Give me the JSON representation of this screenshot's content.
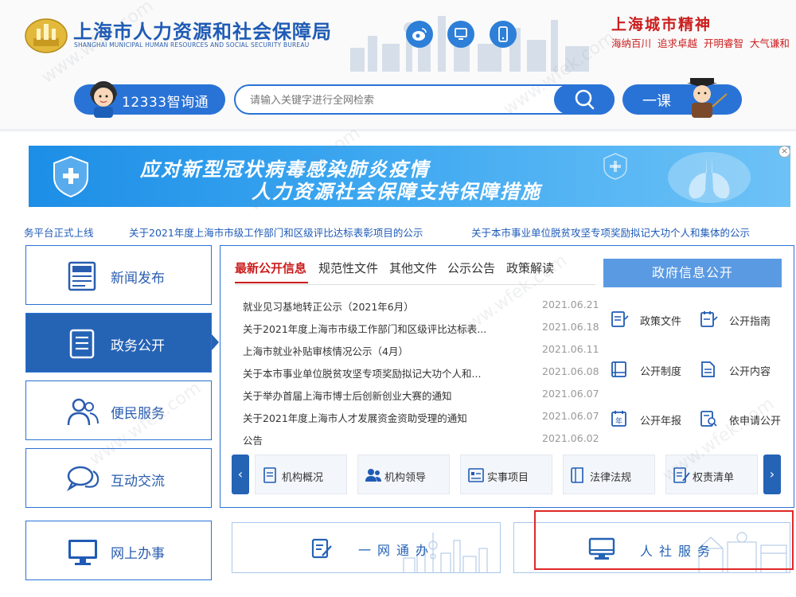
{
  "header": {
    "title": "上海市人力资源和社会保障局",
    "subtitle": "SHANGHAI MUNICIPAL HUMAN RESOURCES AND SOCIAL SECURITY BUREAU",
    "spirit_title": "上海城市精神",
    "spirit_words": "海纳百川  追求卓越  开明睿智  大气谦和",
    "social_icons": [
      "weibo-icon",
      "computer-icon",
      "mobile-icon"
    ]
  },
  "search": {
    "hotline_label": "12333智询通",
    "placeholder": "请输入关键字进行全网检索",
    "lesson_label": "一课"
  },
  "banner": {
    "line1": "应对新型冠状病毒感染肺炎疫情",
    "line2": "人力资源社会保障支持保障措施",
    "close": "×"
  },
  "ticker": [
    "务平台正式上线",
    "关于2021年度上海市市级工作部门和区级评比达标表彰项目的公示",
    "关于本市事业单位脱贫攻坚专项奖励拟记大功个人和集体的公示"
  ],
  "sidebar": {
    "items": [
      {
        "label": "新闻发布",
        "icon": "newspaper-icon"
      },
      {
        "label": "政务公开",
        "icon": "document-icon"
      },
      {
        "label": "便民服务",
        "icon": "people-icon"
      },
      {
        "label": "互动交流",
        "icon": "chat-icon"
      },
      {
        "label": "网上办事",
        "icon": "monitor-icon"
      }
    ]
  },
  "tabs": [
    "最新公开信息",
    "规范性文件",
    "其他文件",
    "公示公告",
    "政策解读"
  ],
  "news": [
    {
      "title": "就业见习基地转正公示（2021年6月）",
      "date": "2021.06.21"
    },
    {
      "title": "关于2021年度上海市市级工作部门和区级评比达标表...",
      "date": "2021.06.18"
    },
    {
      "title": "上海市就业补贴审核情况公示（4月）",
      "date": "2021.06.11"
    },
    {
      "title": "关于本市事业单位脱贫攻坚专项奖励拟记大功个人和...",
      "date": "2021.06.08"
    },
    {
      "title": "关于举办首届上海市博士后创新创业大赛的通知",
      "date": "2021.06.07"
    },
    {
      "title": "关于2021年度上海市人才发展资金资助受理的通知",
      "date": "2021.06.07"
    },
    {
      "title": "公告",
      "date": "2021.06.02"
    }
  ],
  "gov_info": {
    "button": "政府信息公开",
    "links": [
      "政策文件",
      "公开指南",
      "公开制度",
      "公开内容",
      "公开年报",
      "依申请公开"
    ]
  },
  "carousel": {
    "prev": "‹",
    "next": "›",
    "items": [
      "机构概况",
      "机构领导",
      "实事项目",
      "法律法规",
      "权责清单"
    ]
  },
  "bottom": {
    "one_net": "一网通办",
    "hr_service": "人社服务"
  },
  "colors": {
    "primary": "#2a73d6",
    "accent_red": "#cc1d1d",
    "nav_active": "#2563b5"
  }
}
